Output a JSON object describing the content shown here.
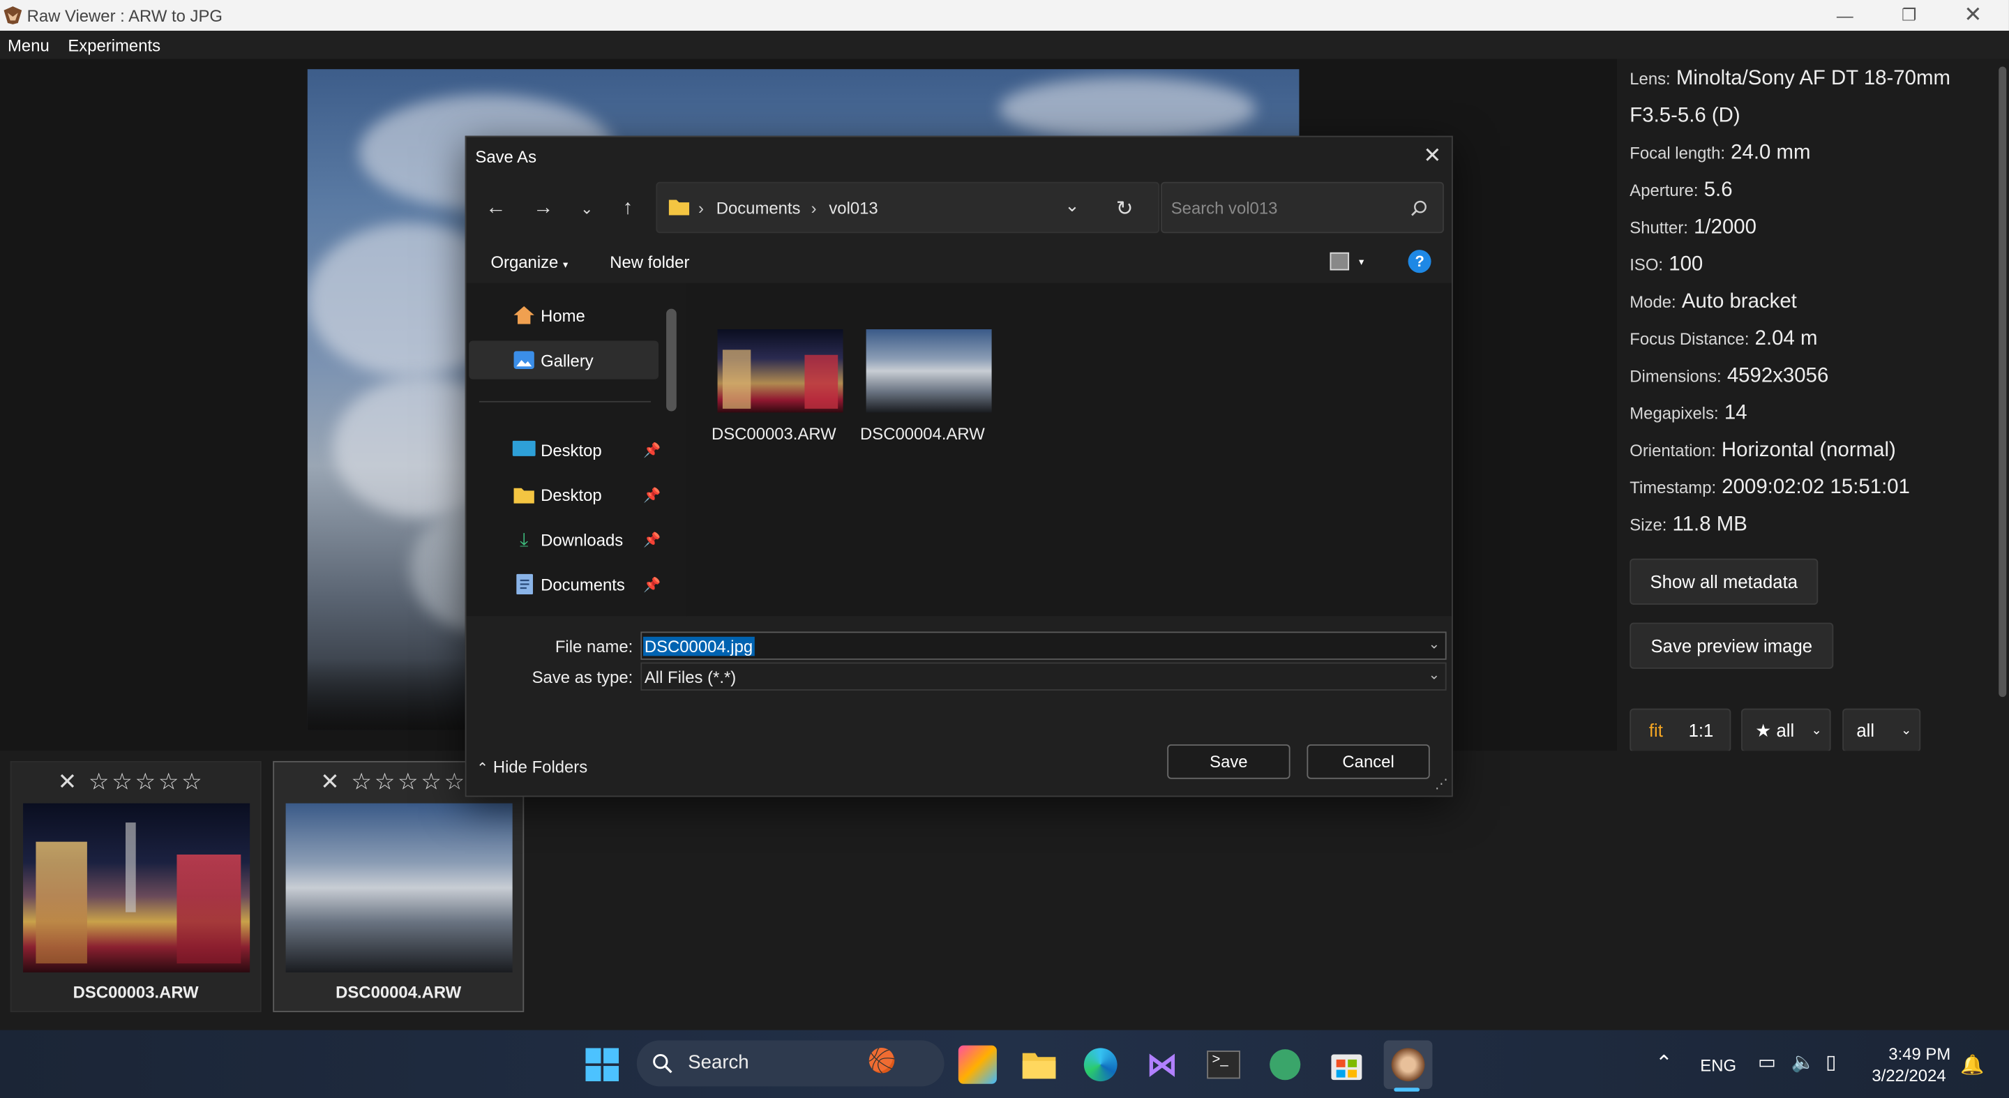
{
  "window": {
    "title": "Raw Viewer : ARW to JPG"
  },
  "menu": {
    "items": [
      "Menu",
      "Experiments"
    ]
  },
  "metadata": [
    {
      "key": "Lens:",
      "value": "Minolta/Sony AF DT 18-70mm",
      "value2": "F3.5-5.6 (D)"
    },
    {
      "key": "Focal length:",
      "value": "24.0 mm"
    },
    {
      "key": "Aperture:",
      "value": "5.6"
    },
    {
      "key": "Shutter:",
      "value": "1/2000"
    },
    {
      "key": "ISO:",
      "value": "100"
    },
    {
      "key": "Mode:",
      "value": "Auto bracket"
    },
    {
      "key": "Focus Distance:",
      "value": "2.04 m"
    },
    {
      "key": "Dimensions:",
      "value": "4592x3056"
    },
    {
      "key": "Megapixels:",
      "value": "14"
    },
    {
      "key": "Orientation:",
      "value": "Horizontal (normal)"
    },
    {
      "key": "Timestamp:",
      "value": "2009:02:02 15:51:01"
    },
    {
      "key": "Size:",
      "value": "11.8 MB"
    }
  ],
  "buttons": {
    "show_all_metadata": "Show all metadata",
    "save_preview": "Save preview image"
  },
  "view_controls": {
    "fit": "fit",
    "one_to_one": "1:1",
    "star_filter": "★ all",
    "filter": "all"
  },
  "filmstrip": [
    {
      "name": "DSC00003.ARW",
      "stars": "✕ ☆☆☆☆☆",
      "selected": false
    },
    {
      "name": "DSC00004.ARW",
      "stars": "✕ ☆☆☆☆☆",
      "selected": true
    }
  ],
  "dialog": {
    "title": "Save As",
    "breadcrumb": [
      "Documents",
      "vol013"
    ],
    "search_placeholder": "Search vol013",
    "organize": "Organize",
    "new_folder": "New folder",
    "nav": [
      {
        "label": "Home",
        "icon": "home-icon",
        "pinned": false
      },
      {
        "label": "Gallery",
        "icon": "gallery-icon",
        "pinned": false
      },
      {
        "label": "Desktop",
        "icon": "desktop-icon",
        "pinned": true
      },
      {
        "label": "Desktop",
        "icon": "folder-icon",
        "pinned": true
      },
      {
        "label": "Downloads",
        "icon": "download-icon",
        "pinned": true
      },
      {
        "label": "Documents",
        "icon": "documents-icon",
        "pinned": true
      }
    ],
    "files": [
      "DSC00003.ARW",
      "DSC00004.ARW"
    ],
    "file_name_label": "File name:",
    "file_name_value": "DSC00004.jpg",
    "save_type_label": "Save as type:",
    "save_type_value": "All Files (*.*)",
    "hide_folders": "Hide Folders",
    "save": "Save",
    "cancel": "Cancel"
  },
  "taskbar": {
    "search": "Search",
    "lang": "ENG",
    "time": "3:49 PM",
    "date": "3/22/2024"
  },
  "colors": {
    "accent": "#0063b1",
    "fit_active": "#f5a623",
    "help_blue": "#1e88e5"
  }
}
